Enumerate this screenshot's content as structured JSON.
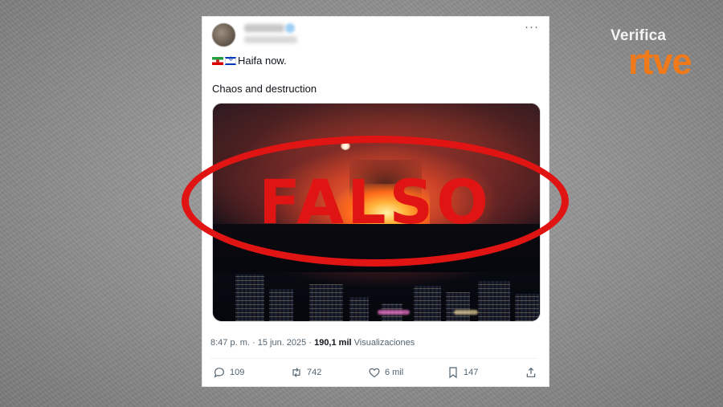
{
  "brand": {
    "verifica": "Verifica",
    "rtve": "rtve",
    "verifica_color": "#f4f4f4",
    "rtve_color": "#f07a1a"
  },
  "tweet": {
    "flags": [
      "iran-flag",
      "israel-flag"
    ],
    "line1": "Haifa now.",
    "line2": "Chaos and destruction",
    "more_icon": "more-horizontal-icon"
  },
  "stamp": {
    "text": "FALSO",
    "color": "#e11414"
  },
  "meta": {
    "time": "8:47 p. m.",
    "separator": "·",
    "date": "15 jun. 2025",
    "views_value": "190,1 mil",
    "views_label": "Visualizaciones"
  },
  "actions": {
    "reply": {
      "icon": "reply-icon",
      "count": "109"
    },
    "retweet": {
      "icon": "retweet-icon",
      "count": "742"
    },
    "like": {
      "icon": "heart-icon",
      "count": "6 mil"
    },
    "bookmark": {
      "icon": "bookmark-icon",
      "count": "147"
    },
    "share": {
      "icon": "share-icon"
    }
  }
}
